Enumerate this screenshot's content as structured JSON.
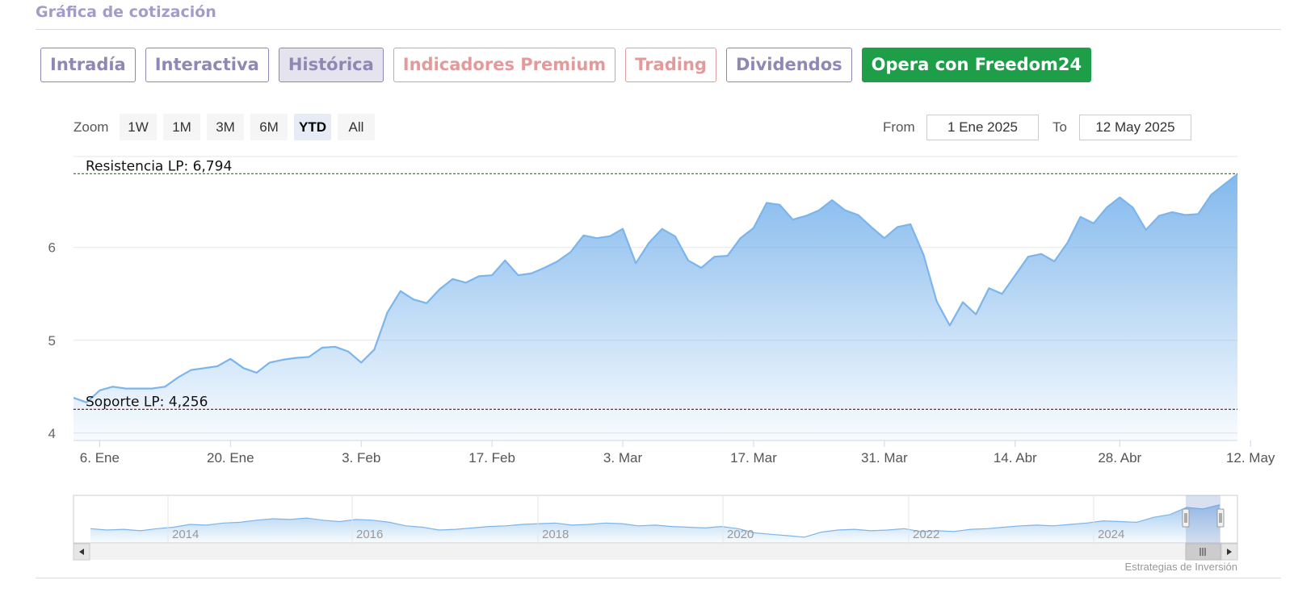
{
  "header": {
    "title": "Gráfica de cotización"
  },
  "tabs": [
    {
      "label": "Intradía",
      "style": "normal"
    },
    {
      "label": "Interactiva",
      "style": "normal"
    },
    {
      "label": "Histórica",
      "style": "active"
    },
    {
      "label": "Indicadores Premium",
      "style": "premium"
    },
    {
      "label": "Trading",
      "style": "premium"
    },
    {
      "label": "Dividendos",
      "style": "normal"
    },
    {
      "label": "Opera con Freedom24",
      "style": "cta"
    }
  ],
  "range_selector": {
    "zoom_label": "Zoom",
    "buttons": [
      "1W",
      "1M",
      "3M",
      "6M",
      "YTD",
      "All"
    ],
    "selected": "YTD",
    "from_label": "From",
    "from_value": "1 Ene 2025",
    "to_label": "To",
    "to_value": "12 May 2025"
  },
  "colors": {
    "line": "#7cb5ec",
    "resistance": "#2e8b2e",
    "support": "#a01818",
    "tab_accent": "#8f88b4",
    "premium_accent": "#e39a9a",
    "cta": "#1e9e48"
  },
  "chart_data": {
    "type": "area",
    "title": "",
    "xlabel": "",
    "ylabel": "",
    "ylim": [
      3.92,
      6.98
    ],
    "yticks": [
      4,
      5,
      6
    ],
    "xticks": [
      {
        "label": "6. Ene",
        "index": 2
      },
      {
        "label": "20. Ene",
        "index": 12
      },
      {
        "label": "3. Feb",
        "index": 22
      },
      {
        "label": "17. Feb",
        "index": 32
      },
      {
        "label": "3. Mar",
        "index": 42
      },
      {
        "label": "17. Mar",
        "index": 52
      },
      {
        "label": "31. Mar",
        "index": 62
      },
      {
        "label": "14. Abr",
        "index": 72
      },
      {
        "label": "28. Abr",
        "index": 80
      },
      {
        "label": "12. May",
        "index": 90
      }
    ],
    "series": [
      {
        "values": [
          4.38,
          4.33,
          4.46,
          4.5,
          4.48,
          4.48,
          4.48,
          4.5,
          4.6,
          4.68,
          4.7,
          4.72,
          4.8,
          4.7,
          4.65,
          4.76,
          4.79,
          4.81,
          4.82,
          4.92,
          4.93,
          4.88,
          4.76,
          4.9,
          5.3,
          5.53,
          5.44,
          5.4,
          5.55,
          5.66,
          5.62,
          5.69,
          5.7,
          5.86,
          5.7,
          5.72,
          5.78,
          5.85,
          5.95,
          6.13,
          6.1,
          6.12,
          6.2,
          5.83,
          6.05,
          6.2,
          6.12,
          5.86,
          5.78,
          5.9,
          5.91,
          6.1,
          6.21,
          6.48,
          6.46,
          6.3,
          6.34,
          6.4,
          6.51,
          6.4,
          6.35,
          6.22,
          6.1,
          6.22,
          6.25,
          5.92,
          5.42,
          5.16,
          5.41,
          5.28,
          5.56,
          5.5,
          5.7,
          5.9,
          5.93,
          5.85,
          6.05,
          6.33,
          6.26,
          6.43,
          6.54,
          6.43,
          6.19,
          6.34,
          6.38,
          6.35,
          6.36,
          6.57,
          6.68,
          6.79
        ]
      }
    ],
    "reference_lines": [
      {
        "label": "Resistencia LP: 6,794",
        "value": 6.794
      },
      {
        "label": "Soporte LP: 4,256",
        "value": 4.256
      }
    ],
    "navigator": {
      "year_labels": [
        "2014",
        "2016",
        "2018",
        "2020",
        "2022",
        "2024"
      ],
      "values": [
        5.1,
        5.0,
        5.05,
        4.95,
        5.1,
        5.2,
        5.4,
        5.35,
        5.5,
        5.55,
        5.7,
        5.8,
        5.75,
        5.85,
        5.7,
        5.6,
        5.75,
        5.7,
        5.55,
        5.3,
        5.2,
        5.0,
        5.05,
        5.15,
        5.25,
        5.3,
        5.4,
        5.45,
        5.5,
        5.35,
        5.4,
        5.5,
        5.45,
        5.3,
        5.35,
        5.25,
        5.2,
        5.15,
        5.25,
        5.1,
        4.8,
        4.7,
        4.6,
        4.5,
        4.85,
        5.0,
        5.05,
        4.95,
        5.0,
        5.1,
        4.9,
        4.95,
        4.9,
        5.05,
        5.1,
        5.2,
        5.3,
        5.35,
        5.3,
        5.4,
        5.5,
        5.65,
        5.6,
        5.55,
        5.9,
        6.1,
        6.6,
        6.5,
        6.79
      ]
    },
    "grid": true,
    "legend": "none"
  },
  "footer": {
    "credit": "Estrategias de Inversión"
  }
}
